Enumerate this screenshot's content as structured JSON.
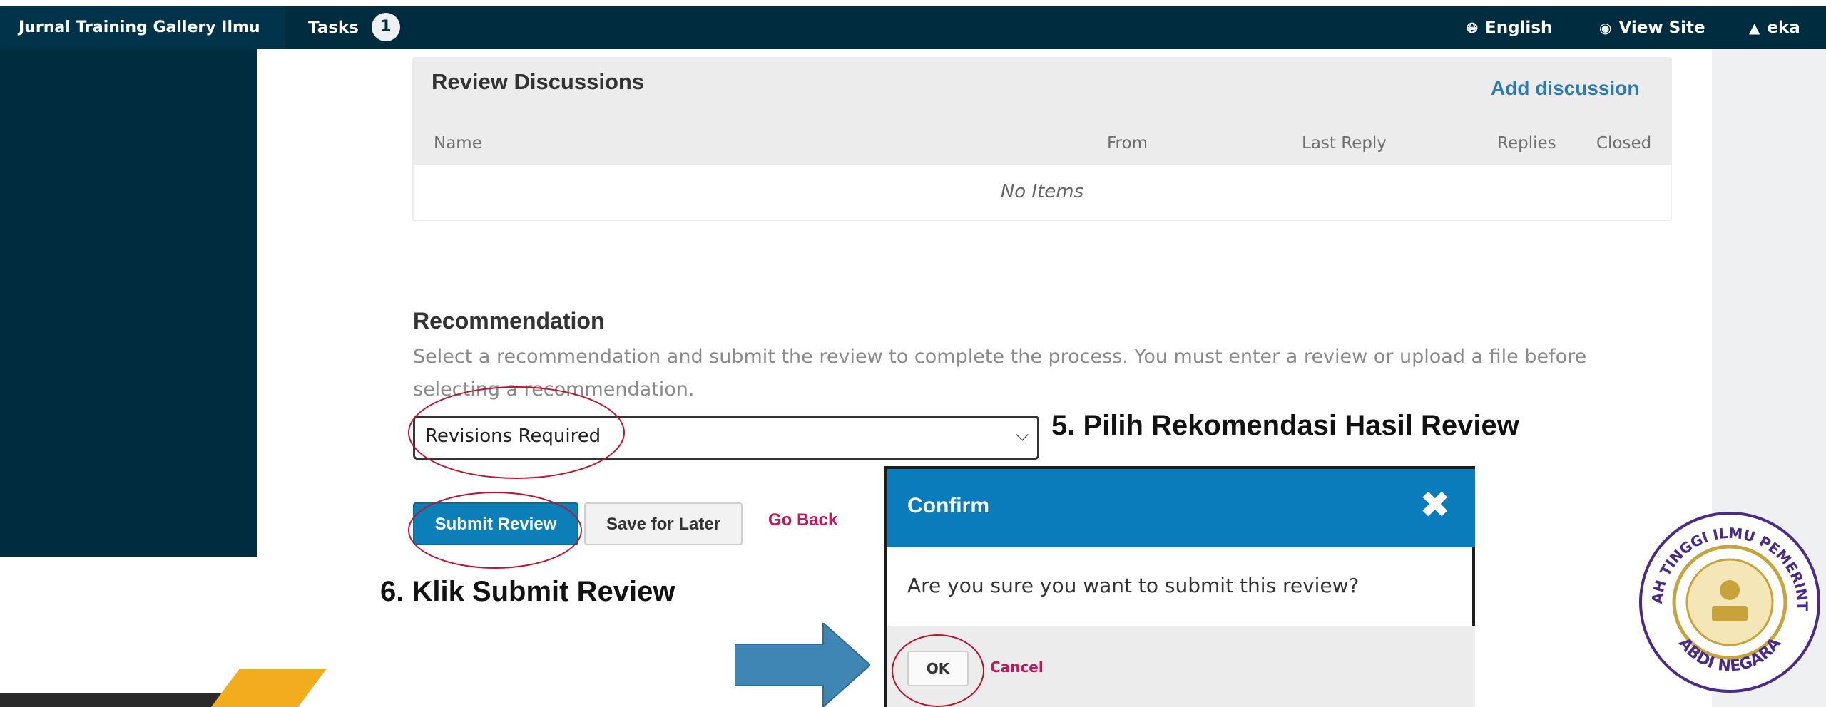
{
  "topbar": {
    "site_name": "Jurnal Training Gallery Ilmu",
    "tasks_label": "Tasks",
    "tasks_count": "1",
    "language": "English",
    "view_site": "View Site",
    "user": "eka"
  },
  "discussions": {
    "title": "Review Discussions",
    "add_label": "Add discussion",
    "columns": [
      "Name",
      "From",
      "Last Reply",
      "Replies",
      "Closed"
    ],
    "empty_text": "No Items"
  },
  "recommendation": {
    "title": "Recommendation",
    "description": "Select a recommendation and submit the review to complete the process. You must enter a review or upload a file before selecting a recommendation.",
    "selected": "Revisions Required",
    "submit_label": "Submit Review",
    "save_label": "Save for Later",
    "back_label": "Go Back"
  },
  "annotations": {
    "step5": "5. Pilih Rekomendasi Hasil Review",
    "step6": "6. Klik Submit Review"
  },
  "dialog": {
    "title": "Confirm",
    "message": "Are you sure you want to submit this review?",
    "ok_label": "OK",
    "cancel_label": "Cancel"
  },
  "logo": {
    "top_text": "SEKOLAH TINGGI ILMU PEMERINTAHAN",
    "bottom_text": "ABDI NEGARA"
  },
  "colors": {
    "nav_bg": "#002c3f",
    "primary_button": "#0d7fb8",
    "link_accent": "#c2185b",
    "annotation_red": "#c0122b",
    "arrow_blue": "#3f86b4",
    "accent_yellow": "#f2ac1d"
  }
}
